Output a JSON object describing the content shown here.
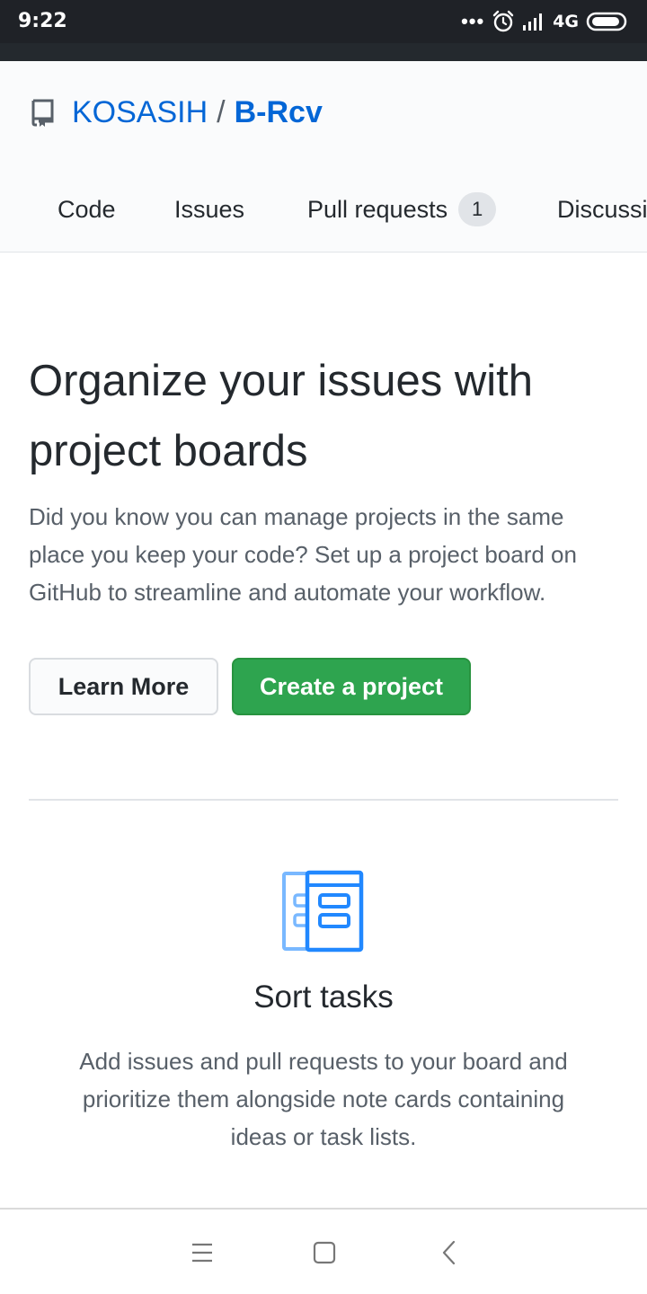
{
  "status_bar": {
    "time": "9:22",
    "dots": "•••",
    "network": "4G",
    "icons": [
      "alarm-icon",
      "signal-icon",
      "battery-icon"
    ]
  },
  "repo": {
    "owner": "KOSASIH",
    "separator": "/",
    "name": "B-Rcv",
    "icon": "repo-icon"
  },
  "tabs": [
    {
      "label": "Code"
    },
    {
      "label": "Issues"
    },
    {
      "label": "Pull requests",
      "count": "1"
    },
    {
      "label": "Discussi"
    }
  ],
  "main": {
    "heading": "Organize your issues with project boards",
    "lead": "Did you know you can manage projects in the same place you keep your code? Set up a project board on GitHub to streamline and automate your workflow.",
    "learn_more_label": "Learn More",
    "create_label": "Create a project"
  },
  "feature": {
    "icon": "project-board-icon",
    "title": "Sort tasks",
    "description": "Add issues and pull requests to your board and prioritize them alongside note cards containing ideas or task lists."
  },
  "nav_bar": {
    "icons": [
      "menu-icon",
      "home-square-icon",
      "back-icon"
    ]
  },
  "colors": {
    "link": "#0366d6",
    "primary_button": "#2ea44f",
    "status_bar": "#1f2227",
    "icon_blue": "#2188ff"
  }
}
